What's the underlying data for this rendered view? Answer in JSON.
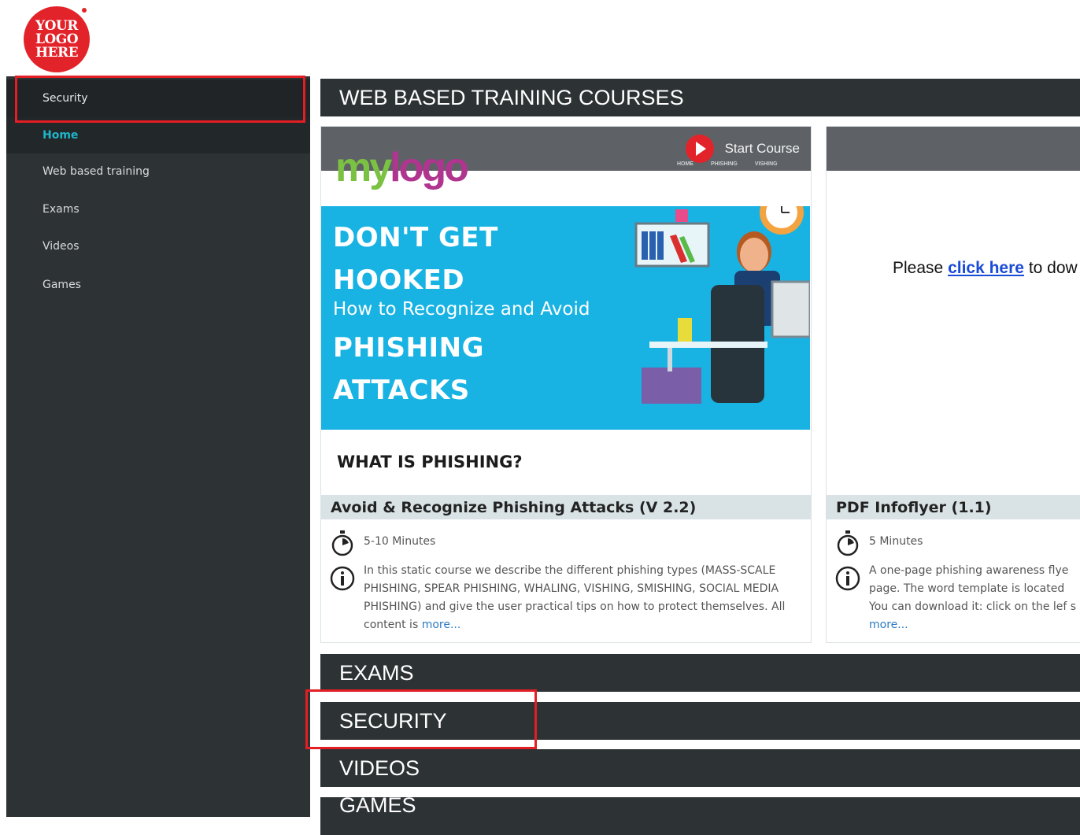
{
  "brand": {
    "logo_text": "YOUR\nLOGO\nHERE"
  },
  "sidebar": {
    "items": [
      {
        "label": "Security"
      },
      {
        "label": "Home"
      },
      {
        "label": "Web based training"
      },
      {
        "label": "Exams"
      },
      {
        "label": "Videos"
      },
      {
        "label": "Games"
      }
    ]
  },
  "sections": {
    "wbt": "WEB BASED TRAINING COURSES",
    "exams": "EXAMS",
    "security": "SECURITY",
    "videos": "VIDEOS",
    "games": "GAMES"
  },
  "cards": [
    {
      "start_label": "Start Course",
      "mini_tabs": [
        "HOME",
        "PHISHING",
        "VISHING"
      ],
      "thumb_logo_a": "my",
      "thumb_logo_b": "logo",
      "banner_line1": "DON'T GET",
      "banner_line2": "HOOKED",
      "banner_sub": "How to Recognize and Avoid",
      "banner_line3": "PHISHING",
      "banner_line4": "ATTACKS",
      "subheading": "WHAT IS PHISHING?",
      "title": "Avoid & Recognize Phishing Attacks (V 2.2)",
      "duration": "5-10 Minutes",
      "description": "In this static course we describe the different phishing types (MASS-SCALE PHISHING, SPEAR PHISHING, WHALING, VISHING, SMISHING, SOCIAL MEDIA PHISHING) and give the user practical tips on how to protect themselves. All content is",
      "more": "more..."
    },
    {
      "please_pre": "Please",
      "please_link": "click here",
      "please_post": "to dow",
      "title": "PDF Infoflyer (1.1)",
      "duration": "5 Minutes",
      "description": "A one-page phishing awareness flye page. The word template is located You can download it: click on the lef s",
      "more": "more..."
    }
  ],
  "colors": {
    "accent": "#1fb6c9",
    "highlight": "#e31e24",
    "bar": "#2d3235",
    "banner": "#18b3e3"
  }
}
